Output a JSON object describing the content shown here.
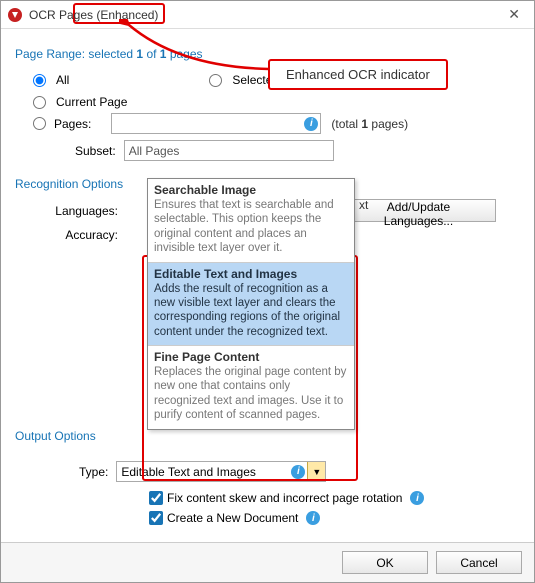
{
  "title": {
    "base": "OCR Pages",
    "suffix": "(Enhanced)"
  },
  "callout": "Enhanced OCR indicator",
  "pageRange": {
    "label_prefix": "Page Range: selected ",
    "selected": "1",
    "label_mid": " of ",
    "total": "1",
    "label_suffix": " pages",
    "all": "All",
    "selectedPages": "Selected Pages",
    "currentPage": "Current Page",
    "pages": "Pages:",
    "totalPrefix": "(total ",
    "totalCount": "1",
    "totalSuffix": " pages)",
    "subsetLabel": "Subset:",
    "subsetValue": "All Pages"
  },
  "recognition": {
    "header": "Recognition Options",
    "languagesLabel": "Languages:",
    "addLang": "Add/Update Languages...",
    "accuracyLabel": "Accuracy:"
  },
  "output": {
    "header": "Output Options",
    "typeLabel": "Type:",
    "typeValue": "Editable Text and Images",
    "fixSkew": "Fix content skew and incorrect page rotation",
    "createNew": "Create a New Document"
  },
  "options": [
    {
      "title": "Searchable Image",
      "desc": "Ensures that text is searchable and selectable. This option keeps the original content and places an invisible text layer over it.",
      "selected": false
    },
    {
      "title": "Editable Text and Images",
      "desc": "Adds the result of recognition as a new visible text layer and clears the corresponding regions of the original content under the recognized text.",
      "selected": true
    },
    {
      "title": "Fine Page Content",
      "desc": "Replaces the original page content by new one that contains only recognized text and images. Use it to purify content of scanned pages.",
      "selected": false
    }
  ],
  "typeRowText": "xt",
  "buttons": {
    "ok": "OK",
    "cancel": "Cancel"
  }
}
